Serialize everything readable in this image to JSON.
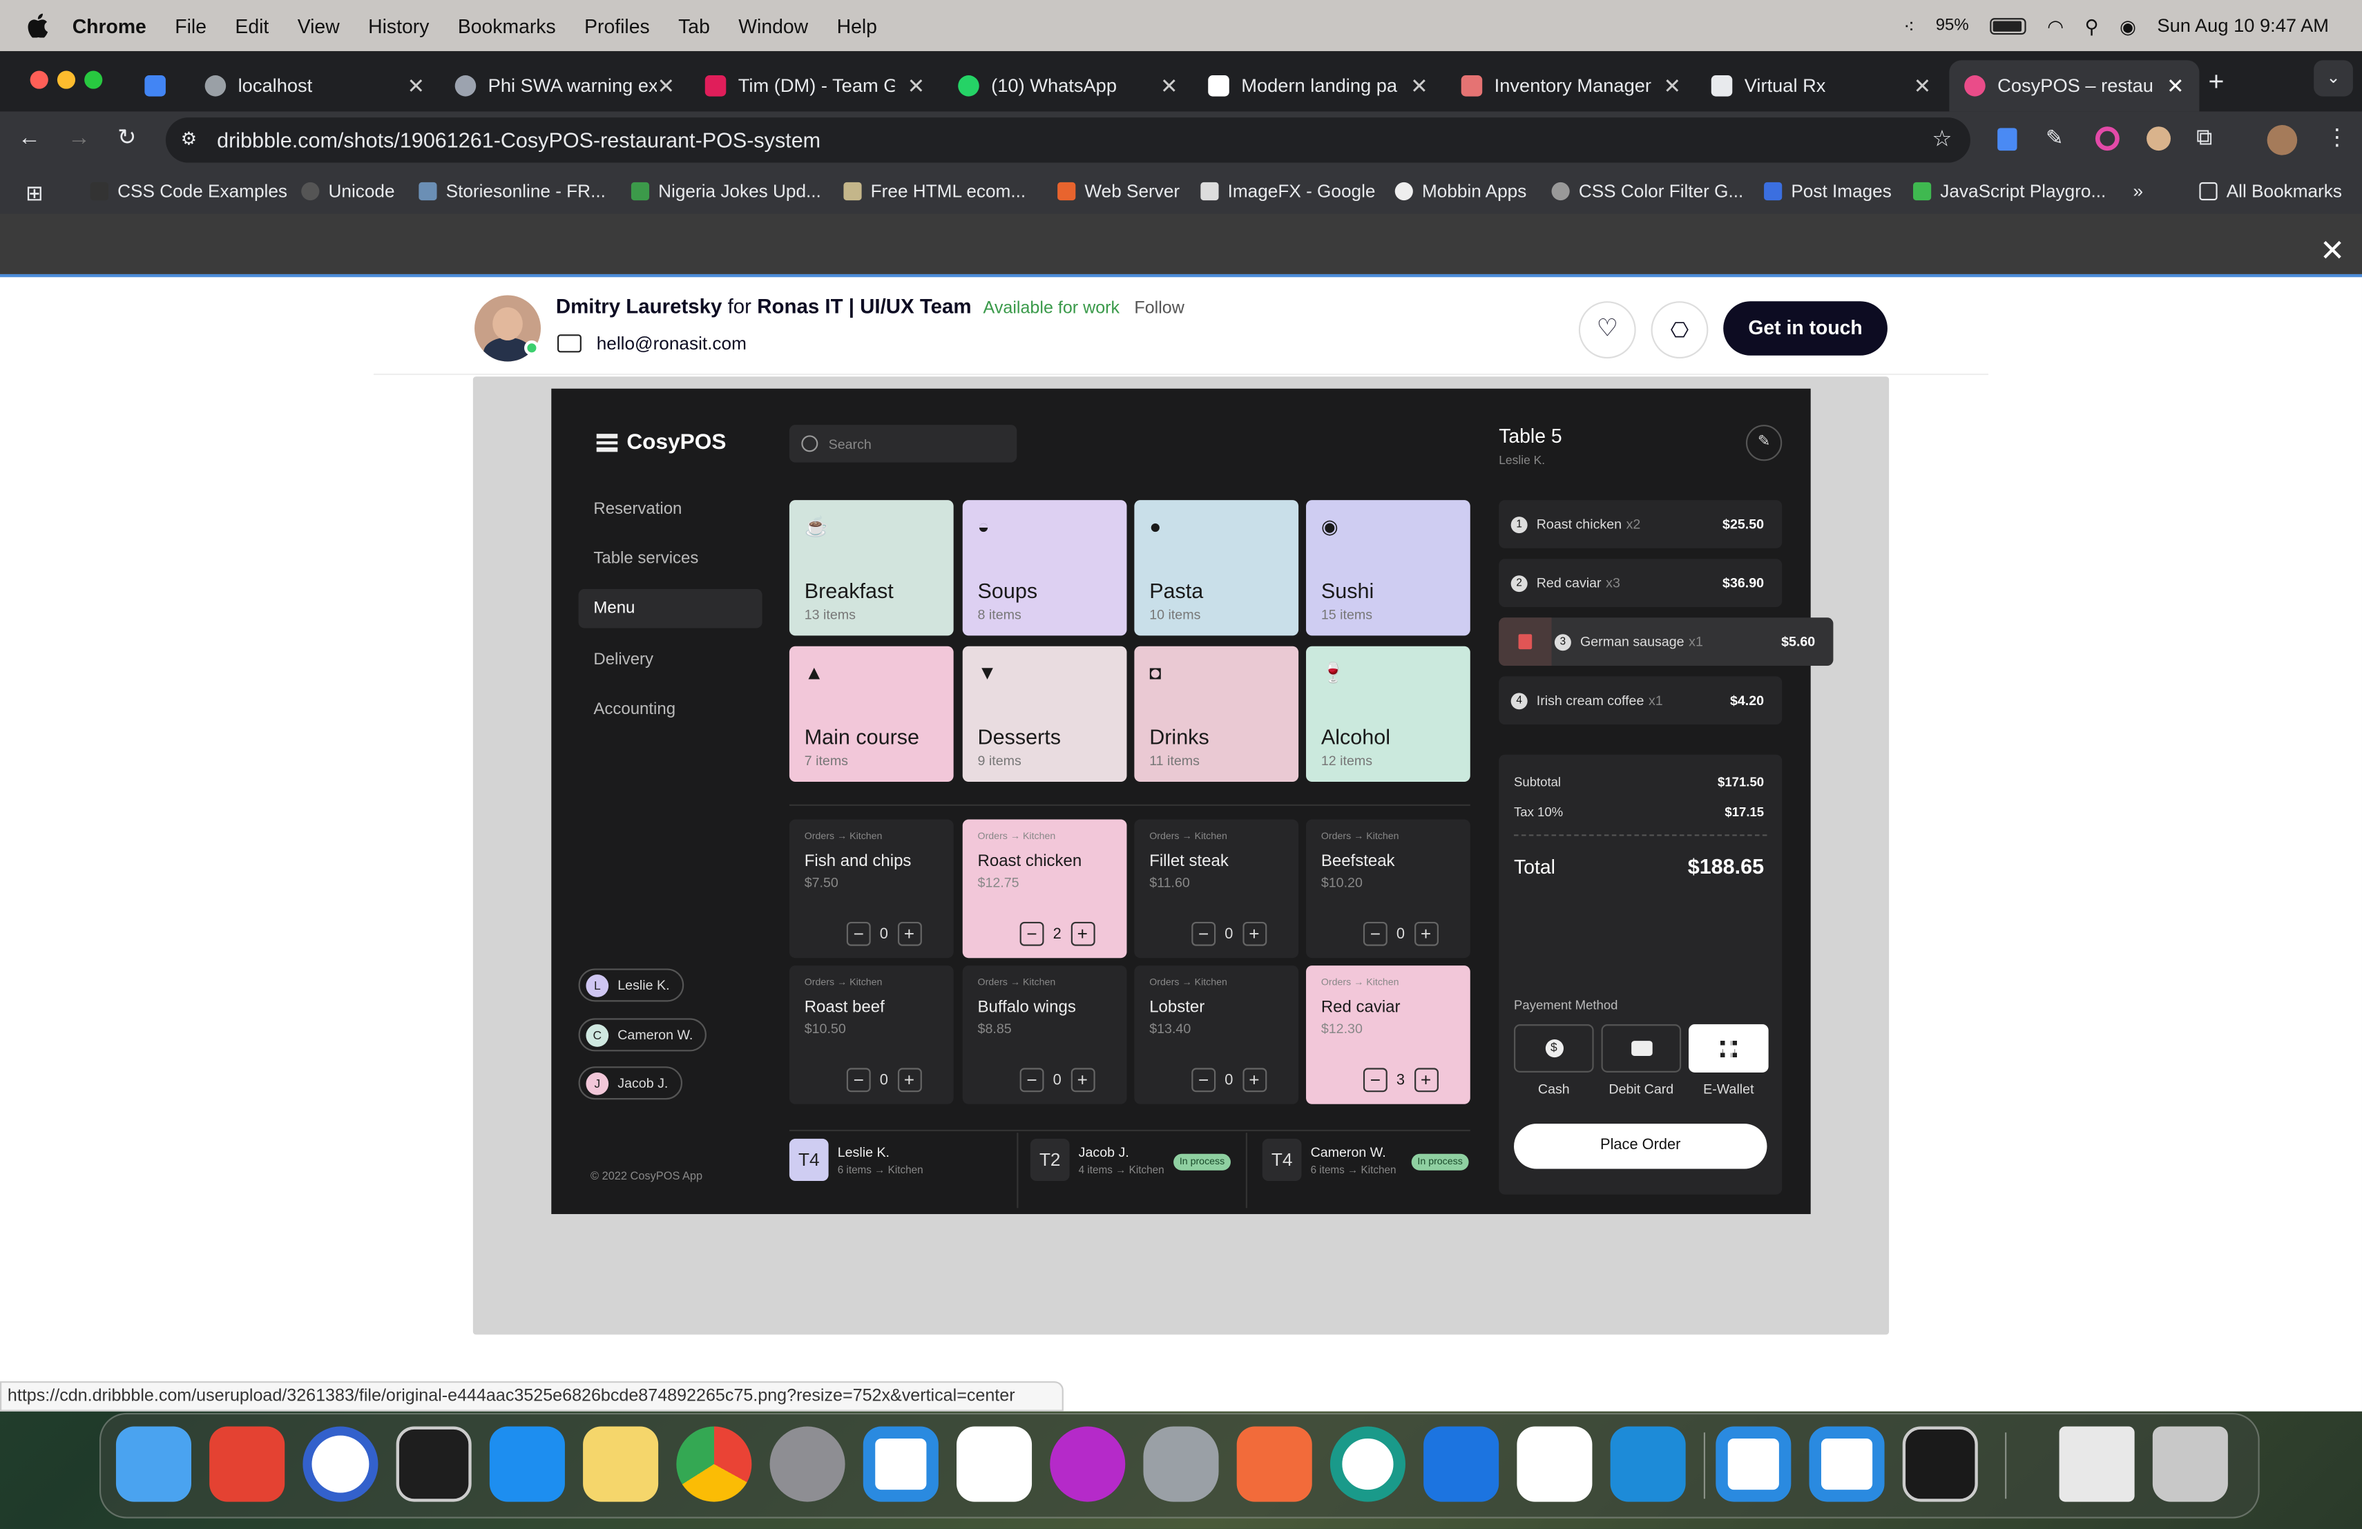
{
  "menubar": {
    "app": "Chrome",
    "items": [
      "File",
      "Edit",
      "View",
      "History",
      "Bookmarks",
      "Profiles",
      "Tab",
      "Window",
      "Help"
    ],
    "battery": "95%",
    "datetime": "Sun Aug 10  9:47 AM"
  },
  "tabs": [
    {
      "title": "localhost",
      "color": "#6b7280"
    },
    {
      "title": "Phi SWA warning ex",
      "color": "#9ca3af"
    },
    {
      "title": "Tim (DM) - Team Gu",
      "color": "#e01e5a"
    },
    {
      "title": "(10) WhatsApp",
      "color": "#25d366"
    },
    {
      "title": "Modern landing pag",
      "color": "#ffffff"
    },
    {
      "title": "Inventory Managem",
      "color": "#e57373"
    },
    {
      "title": "Virtual Rx",
      "color": "#e8eaed"
    },
    {
      "title": "CosyPOS – restaura",
      "color": "#ea4c89"
    }
  ],
  "address": {
    "url": "dribbble.com/shots/19061261-CosyPOS-restaurant-POS-system"
  },
  "bookmarks": [
    "CSS Code Examples",
    "Unicode",
    "Storiesonline - FR...",
    "Nigeria Jokes Upd...",
    "Free HTML ecom...",
    "Web Server",
    "ImageFX - Google",
    "Mobbin Apps",
    "CSS Color Filter G...",
    "Post Images",
    "JavaScript Playgro...",
    "All Bookmarks"
  ],
  "shot_header": {
    "author": "Dmitry Lauretsky",
    "for": "for",
    "team": "Ronas IT | UI/UX Team",
    "available": "Available for work",
    "follow": "Follow",
    "email": "hello@ronasit.com",
    "cta": "Get in touch"
  },
  "pos": {
    "logo": "CosyPOS",
    "search_placeholder": "Search",
    "nav": [
      "Reservation",
      "Table services",
      "Menu",
      "Delivery",
      "Accounting"
    ],
    "staff": [
      {
        "initial": "L",
        "name": "Leslie K.",
        "color": "#cfc6f2"
      },
      {
        "initial": "C",
        "name": "Cameron W.",
        "color": "#cfe8e0"
      },
      {
        "initial": "J",
        "name": "Jacob J.",
        "color": "#f2c7d9"
      }
    ],
    "copyright": "© 2022 CosyPOS App",
    "categories": [
      {
        "name": "Breakfast",
        "count": "13 items",
        "color": "#d2e4dd",
        "icon": "☕"
      },
      {
        "name": "Soups",
        "count": "8 items",
        "color": "#ddd0f2",
        "icon": "🍲"
      },
      {
        "name": "Pasta",
        "count": "10 items",
        "color": "#c9dfe9",
        "icon": "🍝"
      },
      {
        "name": "Sushi",
        "count": "15 items",
        "color": "#cfcdf2",
        "icon": "🍣"
      },
      {
        "name": "Main course",
        "count": "7 items",
        "color": "#f2c7d9",
        "icon": "🍽"
      },
      {
        "name": "Desserts",
        "count": "9 items",
        "color": "#e9dce0",
        "icon": "🍨"
      },
      {
        "name": "Drinks",
        "count": "11 items",
        "color": "#eac9d3",
        "icon": "☕"
      },
      {
        "name": "Alcohol",
        "count": "12 items",
        "color": "#cbe9dd",
        "icon": "🍷"
      }
    ],
    "flow": {
      "from": "Orders",
      "to": "Kitchen"
    },
    "items": [
      {
        "name": "Fish and chips",
        "price": "$7.50",
        "qty": "0",
        "pink": false
      },
      {
        "name": "Roast chicken",
        "price": "$12.75",
        "qty": "2",
        "pink": true
      },
      {
        "name": "Fillet steak",
        "price": "$11.60",
        "qty": "0",
        "pink": false
      },
      {
        "name": "Beefsteak",
        "price": "$10.20",
        "qty": "0",
        "pink": false
      },
      {
        "name": "Roast beef",
        "price": "$10.50",
        "qty": "0",
        "pink": false
      },
      {
        "name": "Buffalo wings",
        "price": "$8.85",
        "qty": "0",
        "pink": false
      },
      {
        "name": "Lobster",
        "price": "$13.40",
        "qty": "0",
        "pink": false
      },
      {
        "name": "Red caviar",
        "price": "$12.30",
        "qty": "3",
        "pink": true
      }
    ],
    "tables": [
      {
        "code": "T4",
        "name": "Leslie K.",
        "items": "6 items",
        "dest": "Kitchen",
        "badge": "",
        "code_bg": "#cfcdf2",
        "code_fg": "#222"
      },
      {
        "code": "T2",
        "name": "Jacob J.",
        "items": "4 items",
        "dest": "Kitchen",
        "badge": "In process",
        "code_bg": "#2b2b2d",
        "code_fg": "#ddd"
      },
      {
        "code": "T4",
        "name": "Cameron W.",
        "items": "6 items",
        "dest": "Kitchen",
        "badge": "In process",
        "code_bg": "#2b2b2d",
        "code_fg": "#ddd"
      }
    ],
    "order": {
      "title": "Table 5",
      "server": "Leslie K.",
      "lines": [
        {
          "n": "1",
          "name": "Roast chicken",
          "qty": "x2",
          "price": "$25.50"
        },
        {
          "n": "2",
          "name": "Red caviar",
          "qty": "x3",
          "price": "$36.90"
        },
        {
          "n": "3",
          "name": "German sausage",
          "qty": "x1",
          "price": "$5.60"
        },
        {
          "n": "4",
          "name": "Irish cream coffee",
          "qty": "x1",
          "price": "$4.20"
        }
      ],
      "subtotal_label": "Subtotal",
      "subtotal": "$171.50",
      "tax_label": "Tax 10%",
      "tax": "$17.15",
      "total_label": "Total",
      "total": "$188.65",
      "payment_label": "Payement Method",
      "methods": [
        "Cash",
        "Debit Card",
        "E-Wallet"
      ],
      "place": "Place Order"
    }
  },
  "status_url": "https://cdn.dribbble.com/userupload/3261383/file/original-e444aac3525e6826bcde874892265c75.png?resize=752x&vertical=center",
  "dock": [
    {
      "name": "Finder",
      "color": "#4aa3f0"
    },
    {
      "name": "Todoist",
      "color": "#e44232"
    },
    {
      "name": "Simplenote",
      "color": "#3361cc"
    },
    {
      "name": "Terminal",
      "color": "#1e1e1e"
    },
    {
      "name": "App Store",
      "color": "#1d8ef0"
    },
    {
      "name": "Notes",
      "color": "#f5d66b"
    },
    {
      "name": "Chrome",
      "color": "#f4f4f4"
    },
    {
      "name": "System Settings",
      "color": "#8e8e93"
    },
    {
      "name": "VS Code",
      "color": "#2a8ae0"
    },
    {
      "name": "MongoDB Compass",
      "color": "#0f4e35"
    },
    {
      "name": "WPS",
      "color": "#b52ac9"
    },
    {
      "name": "Database",
      "color": "#9aa0a6"
    },
    {
      "name": "Postman",
      "color": "#f26b3a"
    },
    {
      "name": "Toolbox",
      "color": "#1a9a8a"
    },
    {
      "name": "Xcode",
      "color": "#1c74e0"
    },
    {
      "name": "ChatGPT",
      "color": "#ffffff"
    },
    {
      "name": "Docker",
      "color": "#1d8bd8"
    },
    {
      "name": "VS Code Insiders",
      "color": "#2a8ae0"
    },
    {
      "name": "VS Code 2",
      "color": "#2a8ae0"
    },
    {
      "name": "Activity Monitor",
      "color": "#1a1a1a"
    },
    {
      "name": "Preview",
      "color": "#e8e8e8"
    },
    {
      "name": "Trash",
      "color": "#c8c8c8"
    }
  ]
}
